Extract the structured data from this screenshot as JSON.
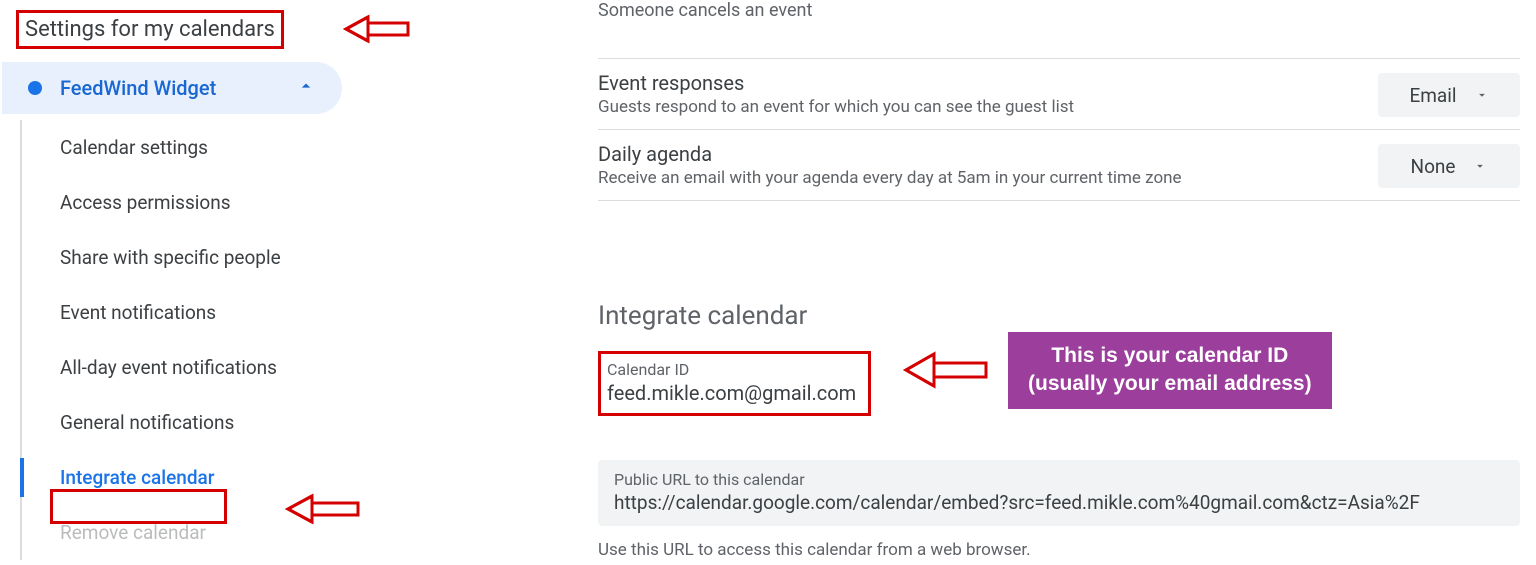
{
  "sidebar": {
    "heading": "Settings for my calendars",
    "calendar_name": "FeedWind Widget",
    "items": [
      "Calendar settings",
      "Access permissions",
      "Share with specific people",
      "Event notifications",
      "All-day event notifications",
      "General notifications",
      "Integrate calendar",
      "Remove calendar"
    ],
    "active_index": 6
  },
  "notifications": {
    "row0": {
      "title": "Someone cancels an event"
    },
    "row1": {
      "title": "Event responses",
      "desc": "Guests respond to an event for which you can see the guest list",
      "value": "Email"
    },
    "row2": {
      "title": "Daily agenda",
      "desc": "Receive an email with your agenda every day at 5am in your current time zone",
      "value": "None"
    }
  },
  "integrate": {
    "heading": "Integrate calendar",
    "calendar_id_label": "Calendar ID",
    "calendar_id_value": "feed.mikle.com@gmail.com",
    "public_url_label": "Public URL to this calendar",
    "public_url_value": "https://calendar.google.com/calendar/embed?src=feed.mikle.com%40gmail.com&ctz=Asia%2F",
    "url_hint": "Use this URL to access this calendar from a web browser."
  },
  "annotations": {
    "callout_line1": "This is your calendar ID",
    "callout_line2": "(usually your email address)"
  }
}
